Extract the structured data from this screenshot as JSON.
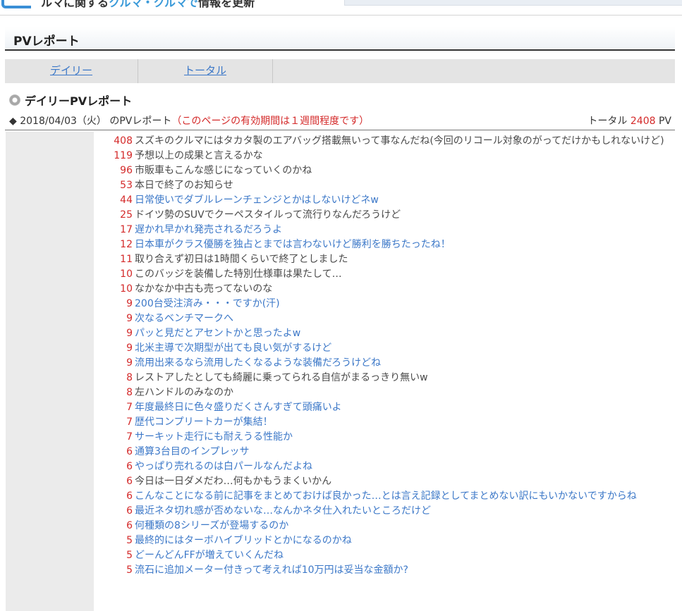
{
  "header": {
    "logo_text_1": "ク",
    "logo_text_2": "ルマに関する",
    "logo_text_hl": "クルマ・クルマで",
    "logo_text_3": "情報を更新"
  },
  "section": {
    "title": "PVレポート"
  },
  "tabs": [
    {
      "label": "デイリー"
    },
    {
      "label": "トータル"
    }
  ],
  "daily": {
    "heading": "デイリーPVレポート",
    "date_text": "◆ 2018/04/03（火） のPVレポート",
    "note": "（このページの有効期間は１週間程度です）",
    "total_label": "トータル",
    "total_value": "2408",
    "total_unit": "PV"
  },
  "colors": {
    "accent_red": "#d42a2a",
    "link_blue": "#3c78c8",
    "text_dark": "#4a4a4a"
  },
  "entries": [
    {
      "count": "408",
      "title": "スズキのクルマにはタカタ製のエアバッグ搭載無いって事なんだね(今回のリコール対象のがってだけかもしれないけど)",
      "style": "dark"
    },
    {
      "count": "119",
      "title": "予想以上の成果と言えるかな",
      "style": "dark"
    },
    {
      "count": "96",
      "title": "市販車もこんな感じになっていくのかね",
      "style": "dark"
    },
    {
      "count": "53",
      "title": "本日で終了のお知らせ",
      "style": "dark"
    },
    {
      "count": "44",
      "title": "日常使いでダブルレーンチェンジとかはしないけどネw",
      "style": "link"
    },
    {
      "count": "25",
      "title": "ドイツ勢のSUVでクーペスタイルって流行りなんだろうけど",
      "style": "dark"
    },
    {
      "count": "17",
      "title": "遅かれ早かれ発売されるだろうよ",
      "style": "link"
    },
    {
      "count": "12",
      "title": "日本車がクラス優勝を独占とまでは言わないけど勝利を勝ちたったね！",
      "style": "link"
    },
    {
      "count": "11",
      "title": "取り合えず初日は1時間くらいで終了としました",
      "style": "dark"
    },
    {
      "count": "10",
      "title": "このバッジを装備した特別仕様車は果たして…",
      "style": "dark"
    },
    {
      "count": "10",
      "title": "なかなか中古も売ってないのな",
      "style": "dark"
    },
    {
      "count": "9",
      "title": "200台受注済み・・・ですか(汗)",
      "style": "link"
    },
    {
      "count": "9",
      "title": "次なるベンチマークへ",
      "style": "link"
    },
    {
      "count": "9",
      "title": "パッと見だとアセントかと思ったよw",
      "style": "link"
    },
    {
      "count": "9",
      "title": "北米主導で次期型が出ても良い気がするけど",
      "style": "link"
    },
    {
      "count": "9",
      "title": "流用出来るなら流用したくなるような装備だろうけどね",
      "style": "link"
    },
    {
      "count": "8",
      "title": "レストアしたとしても綺麗に乗ってられる自信がまるっきり無いw",
      "style": "dark"
    },
    {
      "count": "8",
      "title": "左ハンドルのみなのか",
      "style": "dark"
    },
    {
      "count": "7",
      "title": "年度最終日に色々盛りだくさんすぎて頭痛いよ",
      "style": "link"
    },
    {
      "count": "7",
      "title": "歴代コンプリートカーが集結！",
      "style": "link"
    },
    {
      "count": "7",
      "title": "サーキット走行にも耐えうる性能か",
      "style": "link"
    },
    {
      "count": "6",
      "title": "通算3台目のインプレッサ",
      "style": "link"
    },
    {
      "count": "6",
      "title": "やっぱり売れるのは白パールなんだよね",
      "style": "link"
    },
    {
      "count": "6",
      "title": "今日は一日ダメだわ…何もかもうまくいかん",
      "style": "dark"
    },
    {
      "count": "6",
      "title": "こんなことになる前に記事をまとめておけば良かった…とは言え記録としてまとめない訳にもいかないですからね",
      "style": "link"
    },
    {
      "count": "6",
      "title": "最近ネタ切れ感が否めないな…なんかネタ仕入れたいところだけど",
      "style": "link"
    },
    {
      "count": "6",
      "title": "何種類の8シリーズが登場するのか",
      "style": "link"
    },
    {
      "count": "5",
      "title": "最終的にはターボハイブリッドとかになるのかね",
      "style": "link"
    },
    {
      "count": "5",
      "title": "どーんどんFFが増えていくんだね",
      "style": "link"
    },
    {
      "count": "5",
      "title": "流石に追加メーター付きって考えれば10万円は妥当な金額か?",
      "style": "link"
    }
  ]
}
